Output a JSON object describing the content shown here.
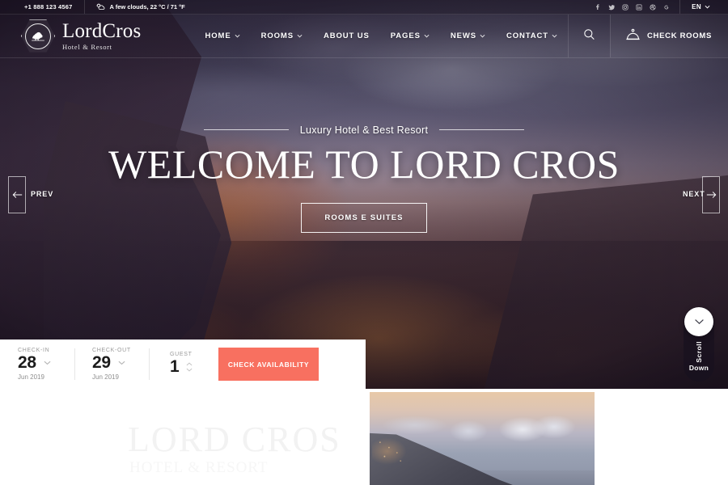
{
  "topbar": {
    "phone": "+1 888 123 4567",
    "weather": "A few clouds, 22 °C / 71 °F",
    "weather_icon": "partly-cloudy-icon",
    "socials": [
      {
        "name": "facebook-icon"
      },
      {
        "name": "twitter-icon"
      },
      {
        "name": "instagram-icon"
      },
      {
        "name": "linkedin-icon"
      },
      {
        "name": "dribbble-icon"
      },
      {
        "name": "google-plus-icon"
      }
    ],
    "language": "EN"
  },
  "header": {
    "brand_name": "LordCros",
    "brand_tagline": "Hotel & Resort",
    "logo_icon": "lion-crest-icon",
    "nav": [
      {
        "label": "HOME",
        "has_dropdown": true
      },
      {
        "label": "ROOMS",
        "has_dropdown": true
      },
      {
        "label": "ABOUT US",
        "has_dropdown": false
      },
      {
        "label": "PAGES",
        "has_dropdown": true
      },
      {
        "label": "NEWS",
        "has_dropdown": true
      },
      {
        "label": "CONTACT",
        "has_dropdown": true
      }
    ],
    "search_icon": "search-icon",
    "check_rooms_icon": "service-bell-icon",
    "check_rooms_label": "CHECK ROOMS"
  },
  "hero": {
    "subtitle": "Luxury Hotel & Best Resort",
    "title": "WELCOME TO LORD CROS",
    "cta_label": "ROOMS E SUITES",
    "prev_label": "PREV",
    "next_label": "NEXT"
  },
  "scroll": {
    "icon": "chevron-down-icon",
    "line1": "Scroll",
    "line2": "Down"
  },
  "booking": {
    "checkin": {
      "label": "CHECK-IN",
      "day": "28",
      "month": "Jun 2019"
    },
    "checkout": {
      "label": "CHECK-OUT",
      "day": "29",
      "month": "Jun 2019"
    },
    "guest": {
      "label": "GUEST",
      "count": "1"
    },
    "submit_label": "CHECK AVAILABILITY",
    "accent_color": "#f87060"
  },
  "lower": {
    "watermark": "LORD CROS",
    "subheading": "HOTEL & RESORT",
    "photo_alt": "coastal-town-at-dusk-photo"
  }
}
